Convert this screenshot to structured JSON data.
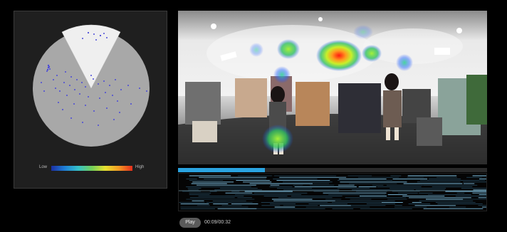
{
  "legend": {
    "low_label": "Low",
    "high_label": "High"
  },
  "player": {
    "play_label": "Play",
    "time_display": "00:09/00:32",
    "progress_fraction": 0.28
  },
  "colors": {
    "accent": "#2aa3e0",
    "background": "#000000",
    "panel": "#1f1f1f",
    "disc": "#a8a8a8",
    "viewport_sector": "#efefef",
    "points": "#4747d6"
  }
}
